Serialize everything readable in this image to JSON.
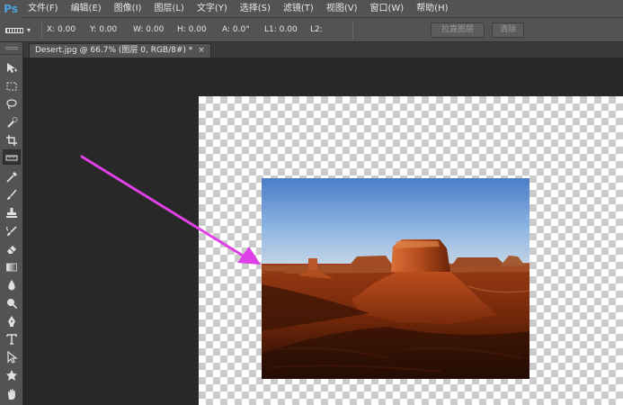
{
  "app": {
    "logo": "Ps"
  },
  "menu": [
    "文件(F)",
    "编辑(E)",
    "图像(I)",
    "图层(L)",
    "文字(Y)",
    "选择(S)",
    "滤镜(T)",
    "视图(V)",
    "窗口(W)",
    "帮助(H)"
  ],
  "options": {
    "x_label": "X: 0.00",
    "y_label": "Y: 0.00",
    "w_label": "W: 0.00",
    "h_label": "H: 0.00",
    "a_label": "A: 0.0°",
    "l1_label": "L1: 0.00",
    "l2_label": "L2:",
    "straighten_label": "拉直图层",
    "clear_label": "清除"
  },
  "document": {
    "tab_title": "Desert.jpg @ 66.7% (图层 0, RGB/8#) *",
    "close_glyph": "×"
  },
  "tools": [
    "move-icon",
    "marquee-icon",
    "lasso-icon",
    "quick-select-icon",
    "crop-icon",
    "ruler-icon",
    "eyedropper-icon",
    "brush-icon",
    "stamp-icon",
    "history-brush-icon",
    "eraser-icon",
    "gradient-icon",
    "blur-icon",
    "dodge-icon",
    "pen-icon",
    "type-icon",
    "path-select-icon",
    "shape-icon",
    "hand-icon"
  ],
  "colors": {
    "annotation_arrow": "#e040e8",
    "ui_panel": "#535353",
    "workspace": "#282828"
  }
}
